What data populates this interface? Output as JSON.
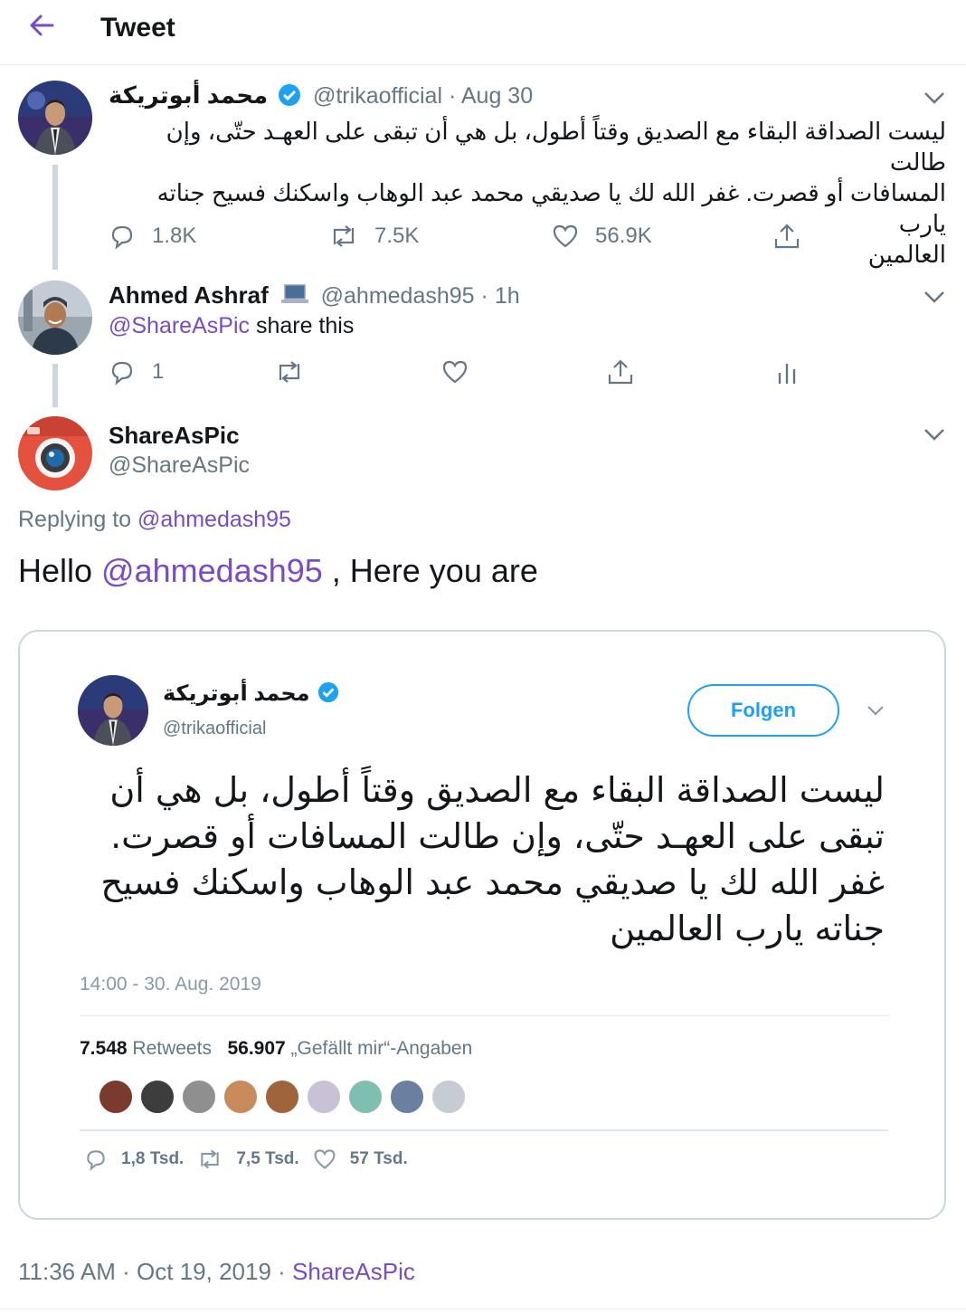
{
  "header": {
    "title": "Tweet"
  },
  "colors": {
    "accent": "#794bc4",
    "verified": "#1da1f2",
    "muted": "#657786"
  },
  "tweet1": {
    "name": "محمد أبوتريكة",
    "handle": "@trikaofficial",
    "date": "Aug 30",
    "text_line1": "ليست الصداقة البقاء مع الصديق وقتاً أطول، بل هي أن تبقى على العهـد حتّى، وإن طالت",
    "text_line2": "المسافات أو قصرت.   غفر الله لك يا صديقي محمد عبد الوهاب واسكنك فسيح جناته يارب",
    "text_line3": "العالمين",
    "replies": "1.8K",
    "retweets": "7.5K",
    "likes": "56.9K"
  },
  "tweet2": {
    "name": "Ahmed Ashraf",
    "handle": "@ahmedash95",
    "time": "1h",
    "mention": "@ShareAsPic",
    "text": " share this",
    "replies": "1"
  },
  "tweet3": {
    "name": "ShareAsPic",
    "handle": "@ShareAsPic",
    "replying_prefix": "Replying to ",
    "replying_handle": "@ahmedash95",
    "body_hello": "Hello ",
    "body_mention": "@ahmedash95",
    "body_rest": " , Here you are",
    "timestamp": "11:36 AM · Oct 19, 2019 · ",
    "source": "ShareAsPic"
  },
  "card": {
    "name": "محمد أبوتريكة",
    "handle": "@trikaofficial",
    "follow_label": "Folgen",
    "text": "ليست الصداقة البقاء مع الصديق وقتاً أطول، بل هي أن تبقى على العهـد حتّى، وإن طالت المسافات أو قصرت. غفر الله لك يا صديقي محمد عبد الوهاب واسكنك فسيح جناته يارب العالمين",
    "datetime": "14:00 - 30. Aug. 2019",
    "retweets_count": "7.548",
    "retweets_label": "Retweets",
    "likes_count": "56.907",
    "likes_label": "„Gefällt mir“-Angaben",
    "replies_short": "1,8 Tsd.",
    "retweets_short": "7,5 Tsd.",
    "likes_short": "57 Tsd.",
    "face_colors": [
      "#7a3b2e",
      "#3d3d3d",
      "#8f8f8f",
      "#c98a5c",
      "#a0643a",
      "#c9c2d6",
      "#7fbfb0",
      "#6b7fa0",
      "#c5ccd3"
    ]
  }
}
